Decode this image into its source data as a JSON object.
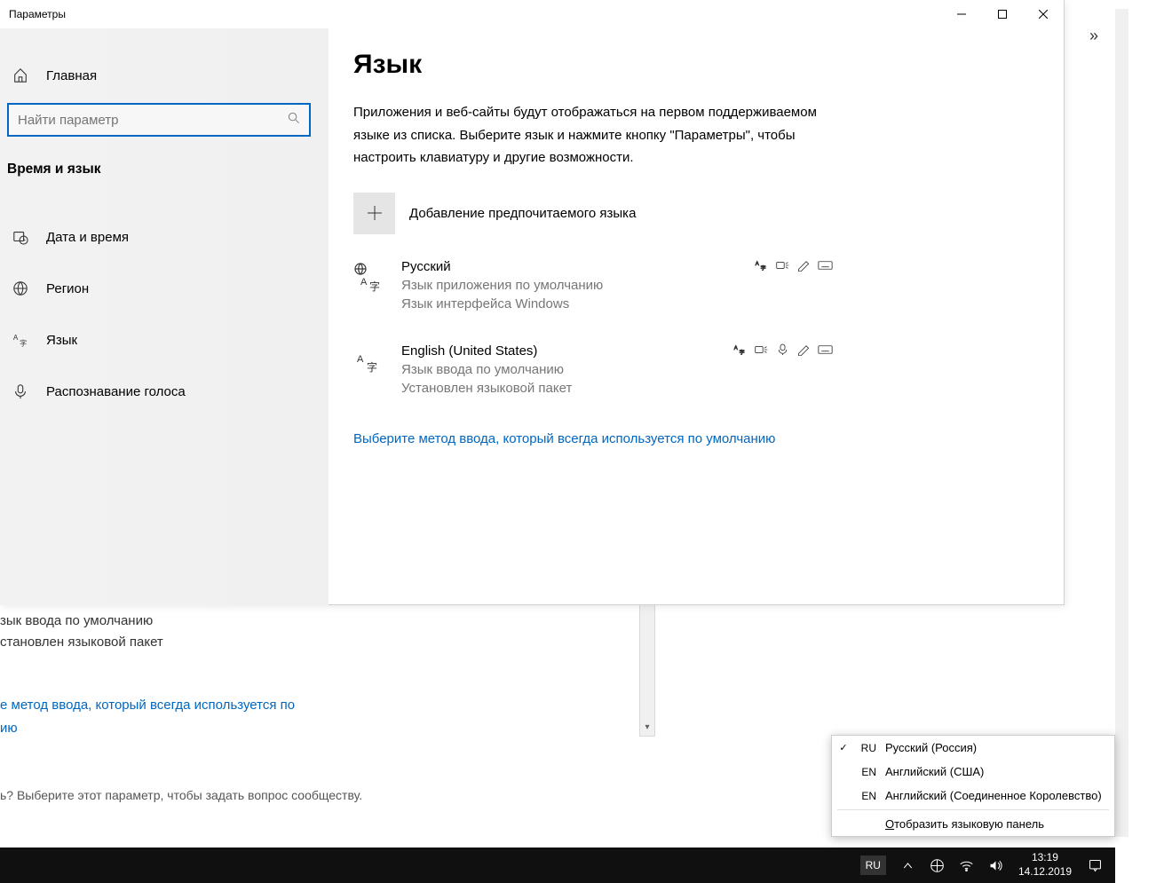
{
  "window_title": "Параметры",
  "overflow_chevron": "»",
  "sidebar": {
    "home": "Главная",
    "search_placeholder": "Найти параметр",
    "category": "Время и язык",
    "items": [
      {
        "label": "Дата и время"
      },
      {
        "label": "Регион"
      },
      {
        "label": "Язык"
      },
      {
        "label": "Распознавание голоса"
      }
    ]
  },
  "main": {
    "heading": "Язык",
    "description": "Приложения и веб-сайты будут отображаться на первом поддерживаемом языке из списка. Выберите язык и нажмите кнопку \"Параметры\", чтобы настроить клавиатуру и другие возможности.",
    "add_label": "Добавление предпочитаемого языка",
    "languages": [
      {
        "name": "Русский",
        "meta1": "Язык приложения по умолчанию",
        "meta2": "Язык интерфейса Windows",
        "has_globe": true,
        "icons": [
          "abc",
          "tts",
          "pen",
          "kbd"
        ]
      },
      {
        "name": "English (United States)",
        "meta1": "Язык ввода по умолчанию",
        "meta2": "Установлен языковой пакет",
        "has_globe": false,
        "icons": [
          "abc",
          "tts",
          "mic",
          "pen",
          "kbd"
        ]
      }
    ],
    "link": "Выберите метод ввода, который всегда используется по умолчанию"
  },
  "background": {
    "line1": "зык ввода по умолчанию",
    "line2": "становлен языковой пакет",
    "link": "е метод ввода, который всегда используется по\nию",
    "question": "ь? Выберите этот параметр, чтобы задать вопрос сообществу."
  },
  "lang_popup": {
    "rows": [
      {
        "checked": true,
        "code": "RU",
        "name": "Русский (Россия)"
      },
      {
        "checked": false,
        "code": "EN",
        "name": "Английский (США)"
      },
      {
        "checked": false,
        "code": "EN",
        "name": "Английский (Соединенное Королевство)"
      }
    ],
    "show_panel_pre": "О",
    "show_panel_rest": "тобразить языковую панель"
  },
  "taskbar": {
    "lang": "RU",
    "time": "13:19",
    "date": "14.12.2019"
  }
}
